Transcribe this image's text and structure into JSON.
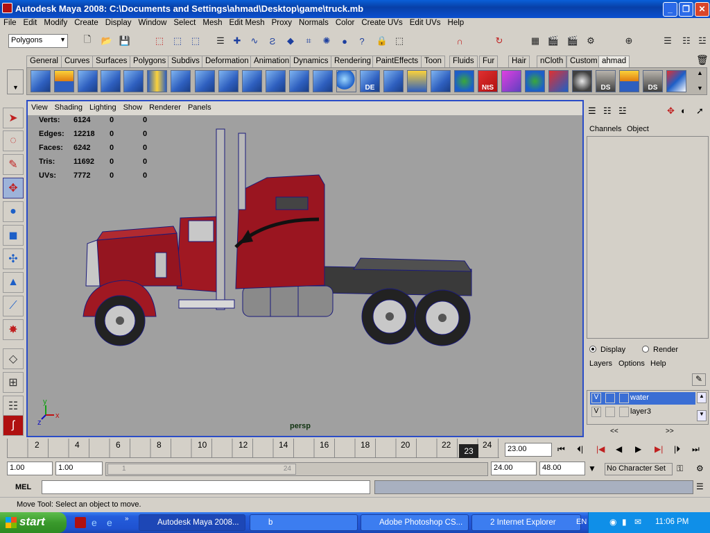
{
  "window": {
    "title": "Autodesk Maya 2008: C:\\Documents and Settings\\ahmad\\Desktop\\game\\truck.mb"
  },
  "menubar": [
    "File",
    "Edit",
    "Modify",
    "Create",
    "Display",
    "Window",
    "Select",
    "Mesh",
    "Edit Mesh",
    "Proxy",
    "Normals",
    "Color",
    "Create UVs",
    "Edit UVs",
    "Help"
  ],
  "statusline": {
    "menuset": "Polygons"
  },
  "shelf": {
    "tabs": [
      "General",
      "Curves",
      "Surfaces",
      "Polygons",
      "Subdivs",
      "Deformation",
      "Animation",
      "Dynamics",
      "Rendering",
      "PaintEffects",
      "Toon",
      "Fluids",
      "Fur",
      "Hair",
      "nCloth",
      "Custom",
      "ahmad"
    ],
    "active_tab": "ahmad",
    "icon_labels": [
      "DE",
      "NtS",
      "DS",
      "DS"
    ]
  },
  "viewport": {
    "menu": [
      "View",
      "Shading",
      "Lighting",
      "Show",
      "Renderer",
      "Panels"
    ],
    "camera": "persp",
    "hud": [
      {
        "label": "Verts:",
        "values": [
          "6124",
          "0",
          "0"
        ]
      },
      {
        "label": "Edges:",
        "values": [
          "12218",
          "0",
          "0"
        ]
      },
      {
        "label": "Faces:",
        "values": [
          "6242",
          "0",
          "0"
        ]
      },
      {
        "label": "Tris:",
        "values": [
          "11692",
          "0",
          "0"
        ]
      },
      {
        "label": "UVs:",
        "values": [
          "7772",
          "0",
          "0"
        ]
      }
    ],
    "axis": {
      "y": "y",
      "x": "x",
      "z": "z"
    }
  },
  "channelbox": {
    "menu": [
      "Channels",
      "Object"
    ]
  },
  "layers": {
    "radio": {
      "display": "Display",
      "render": "Render"
    },
    "menu": [
      "Layers",
      "Options",
      "Help"
    ],
    "rows": [
      {
        "v": "V",
        "name": "water",
        "selected": true
      },
      {
        "v": "V",
        "name": "layer3",
        "selected": false
      }
    ],
    "scroll": [
      "<<",
      ">>"
    ]
  },
  "timeline": {
    "ticks": [
      "2",
      "4",
      "6",
      "8",
      "10",
      "12",
      "14",
      "16",
      "18",
      "20",
      "22",
      "24"
    ],
    "current_frame_marker": "23",
    "current_time": "23.00"
  },
  "range": {
    "start": "1.00",
    "playback_start": "1.00",
    "slider_start": "1",
    "slider_end": "24",
    "playback_end": "24.00",
    "end": "48.00",
    "character_set": "No Character Set"
  },
  "cmdline": {
    "label": "MEL"
  },
  "helpline": {
    "text": "Move Tool: Select an object to move."
  },
  "taskbar": {
    "start": "start",
    "tasks": [
      "Autodesk Maya 2008...",
      "b",
      "Adobe Photoshop CS...",
      "2 Internet Explorer"
    ],
    "lang": "EN",
    "clock": "11:06 PM"
  },
  "colors": {
    "viewport_bg": "#a0a0a0",
    "selection_blue": "#2a4cc7",
    "truck_red": "#a01822"
  }
}
